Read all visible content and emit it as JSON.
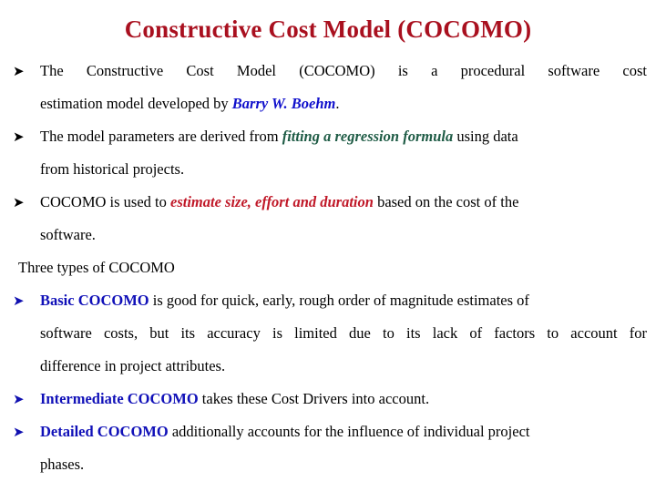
{
  "slide": {
    "title": "Constructive Cost Model (COCOMO)",
    "title_color": "#a9101f",
    "background_color": "#ffffff",
    "body_text_color": "#000000"
  },
  "icons": {
    "bullet_arrow": "arrow-bullet-icon",
    "bullet_glyph": "➤"
  },
  "content": {
    "bullet1": {
      "bullet": "➤",
      "line1": "The Constructive Cost Model (COCOMO) is a procedural software cost",
      "line2_pre": "estimation model developed by ",
      "line2_em": "Barry W. Boehm",
      "line2_post": ".",
      "emphasis_color": "#1010cc"
    },
    "bullet2": {
      "bullet": "➤",
      "line1_pre": "The model parameters are derived from ",
      "line1_em": "fitting a regression formula",
      "line1_post": " using data",
      "line2": "from historical projects.",
      "emphasis_color": "#1f5c46"
    },
    "bullet3": {
      "bullet": "➤",
      "line1_pre": "COCOMO is used to ",
      "line1_em": "estimate size, effort and duration",
      "line1_post": " based on the cost of the",
      "line2": "software.",
      "emphasis_color": "#c01828"
    },
    "heading": {
      "text": "Three types of COCOMO"
    },
    "bullet4": {
      "bullet": "➤",
      "bullet_color": "#1010b0",
      "line1_em": "Basic COCOMO",
      "line1_post": " is good for quick, early, rough order of magnitude estimates of",
      "line2": "software costs, but its accuracy is limited due to its lack of factors to account for",
      "line3": "difference in project attributes.",
      "emphasis_color": "#1010b8"
    },
    "bullet5": {
      "bullet": "➤",
      "bullet_color": "#1010b0",
      "line1_em": "Intermediate COCOMO",
      "line1_post": " takes these Cost Drivers into account.",
      "emphasis_color": "#1010b8"
    },
    "bullet6": {
      "bullet": "➤",
      "bullet_color": "#1010b0",
      "line1_em": "Detailed COCOMO",
      "line1_post": " additionally accounts for the influence of individual project",
      "line2": "phases.",
      "emphasis_color": "#1010b8"
    }
  }
}
